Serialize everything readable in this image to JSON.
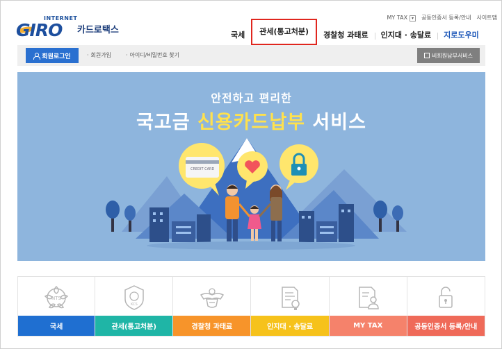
{
  "header": {
    "logo_internet": "INTERNET",
    "logo_text": "GIRO",
    "logo_sub": "카드로택스",
    "util_links": [
      "MY TAX",
      "공동인증서 등록/안내",
      "사이트맵"
    ],
    "nav": [
      "국세",
      "관세(통고처분)",
      "경찰청 과태료",
      "인지대 · 송달료",
      "지로도우미"
    ]
  },
  "subnav": {
    "login": "회원로그인",
    "join": "회원가입",
    "find": "아이디/비밀번호 찾기",
    "nonmember": "비회원납부서비스"
  },
  "banner": {
    "subtitle": "안전하고 편리한",
    "title_prefix": "국고금",
    "title_accent": "신용카드납부",
    "title_suffix": "서비스",
    "card_text": "CREDIT CARD"
  },
  "services": [
    {
      "label": "국세",
      "color": "#1f6fd1",
      "icon": "nts-emblem-icon",
      "emblem_text": "NTS"
    },
    {
      "label": "관세(통고처분)",
      "color": "#1fb5a6",
      "icon": "customs-badge-icon",
      "emblem_text": "KCS"
    },
    {
      "label": "경찰청 과태료",
      "color": "#f7942a",
      "icon": "police-emblem-icon"
    },
    {
      "label": "인지대 · 송달료",
      "color": "#f6c21b",
      "icon": "stamp-document-icon"
    },
    {
      "label": "MY TAX",
      "color": "#f5826b",
      "icon": "user-document-icon"
    },
    {
      "label": "공동인증서 등록/안내",
      "color": "#ef6a59",
      "icon": "lock-icon"
    }
  ],
  "colors": {
    "accent": "#e0261e",
    "brand": "#1d4f9e",
    "banner_bg": "#8eb5dd"
  }
}
